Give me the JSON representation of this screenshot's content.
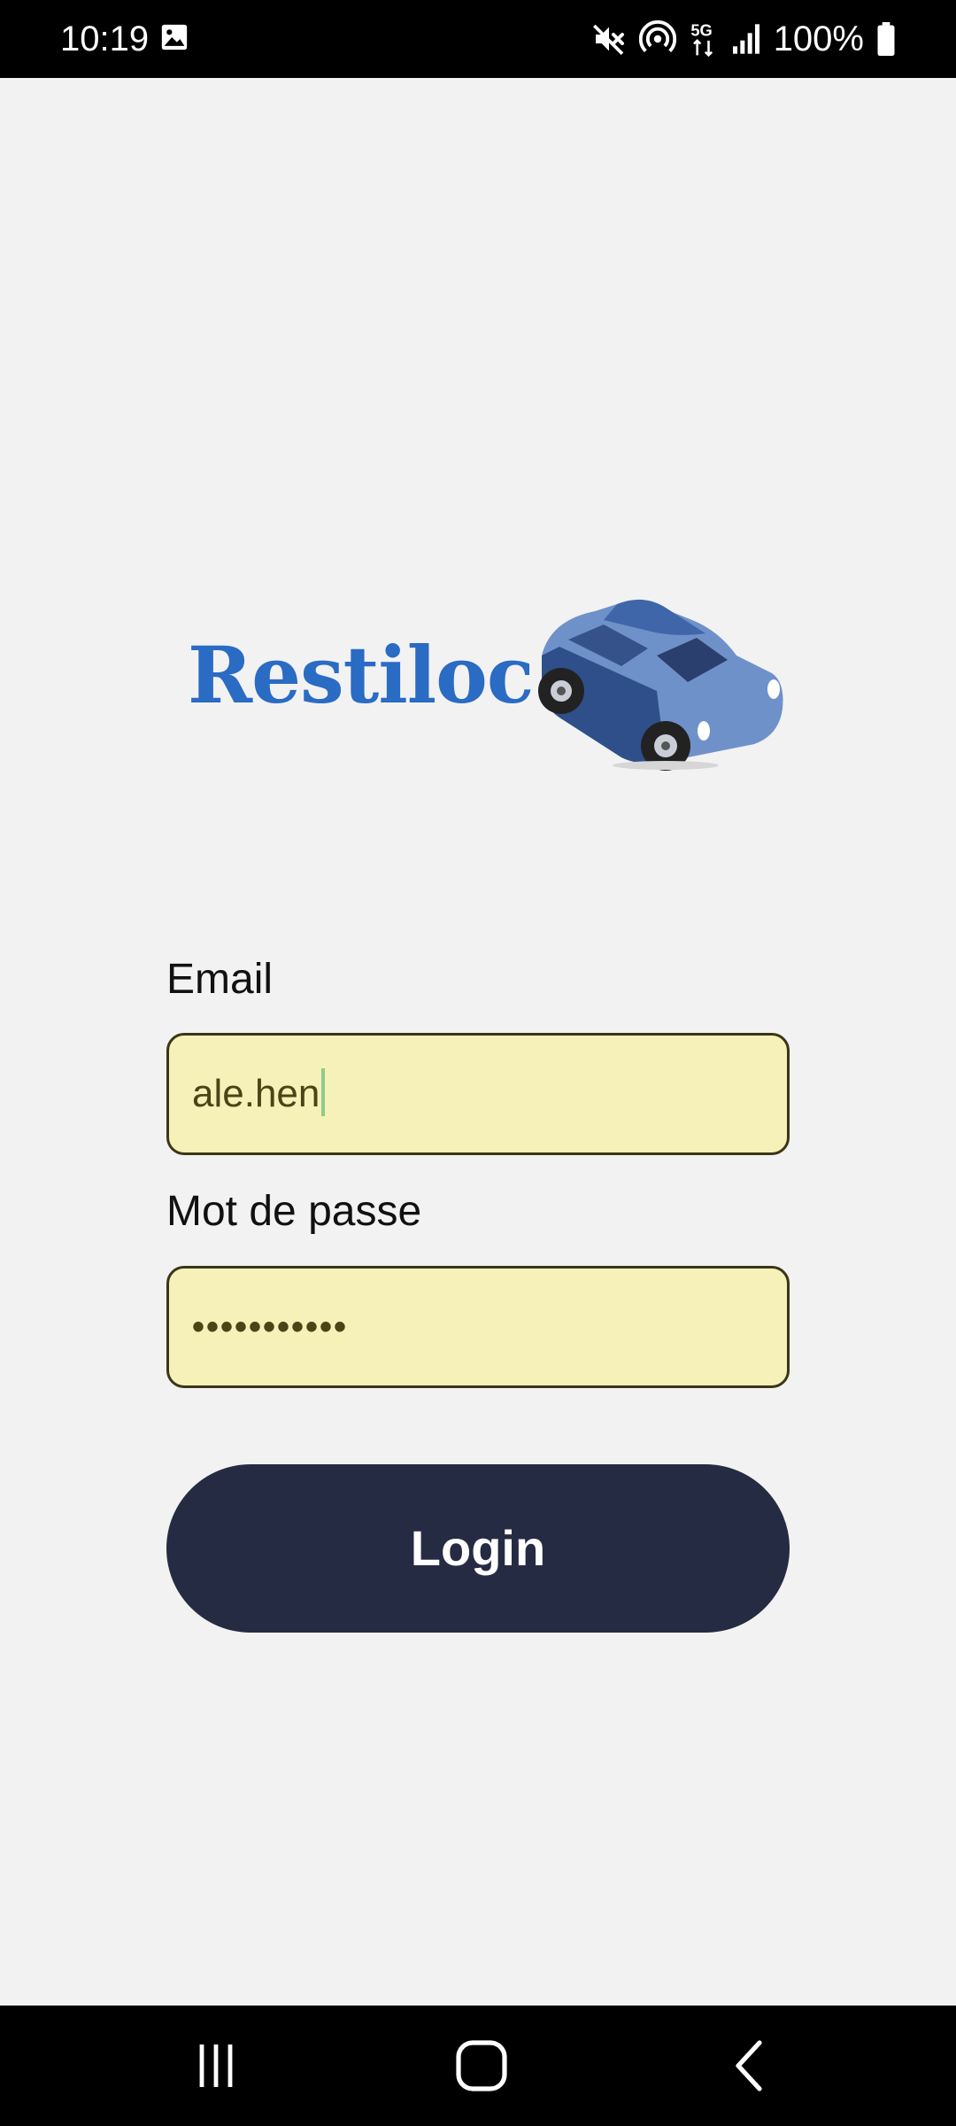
{
  "status_bar": {
    "time": "10:19",
    "battery": "100%",
    "icons": [
      "gallery-icon",
      "mute-icon",
      "hotspot-icon",
      "5g-icon",
      "signal-icon",
      "battery-icon"
    ]
  },
  "logo": {
    "brand": "Restiloc",
    "icon": "car-icon",
    "brand_color": "#2a6bc4"
  },
  "form": {
    "email_label": "Email",
    "email_value": "ale.hen",
    "password_label": "Mot de passe",
    "password_value": "•••••••••••",
    "login_label": "Login"
  },
  "colors": {
    "background": "#f2f2f2",
    "input_fill": "#f6f1b8",
    "button": "#252b42"
  },
  "nav_bar": {
    "icons": [
      "recents-icon",
      "home-icon",
      "back-icon"
    ]
  }
}
